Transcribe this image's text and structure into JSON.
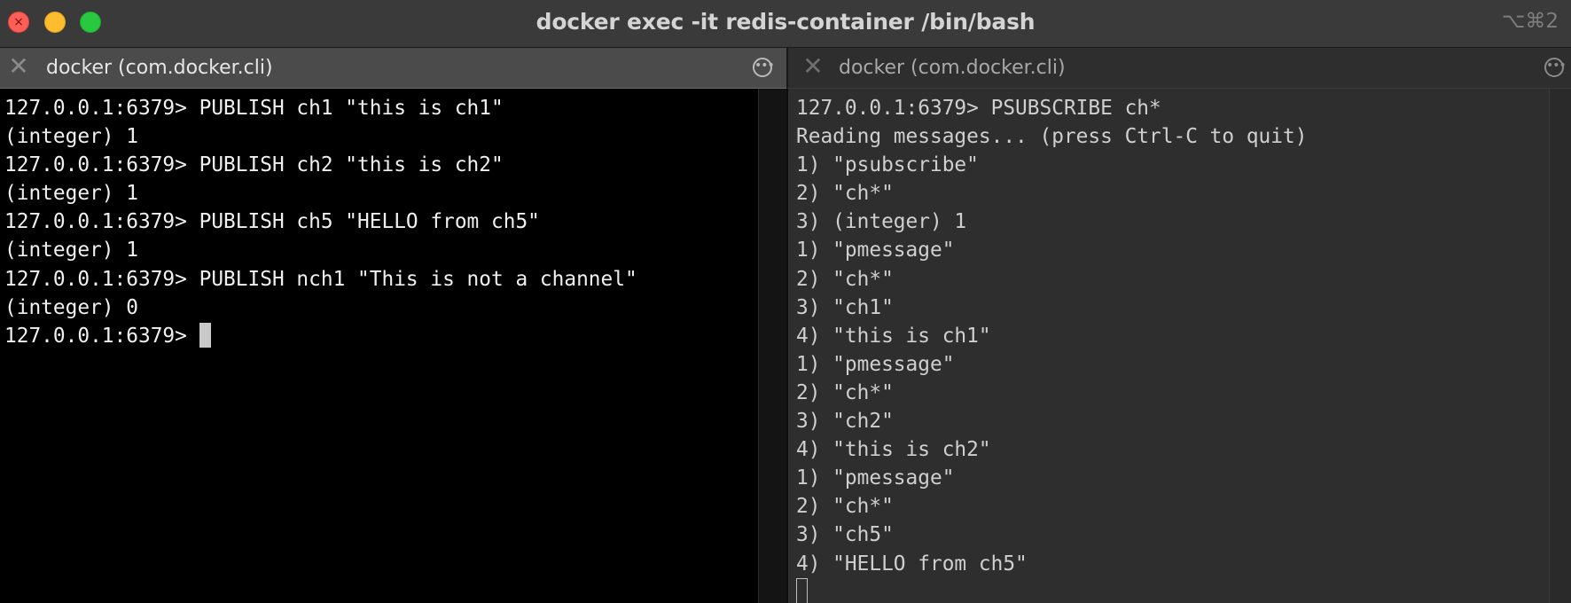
{
  "window": {
    "title": "docker exec -it redis-container /bin/bash",
    "shortcut": "⌥⌘2"
  },
  "left_pane": {
    "tab_label": "docker (com.docker.cli)",
    "lines": [
      "127.0.0.1:6379> PUBLISH ch1 \"this is ch1\"",
      "(integer) 1",
      "127.0.0.1:6379> PUBLISH ch2 \"this is ch2\"",
      "(integer) 1",
      "127.0.0.1:6379> PUBLISH ch5 \"HELLO from ch5\"",
      "(integer) 1",
      "127.0.0.1:6379> PUBLISH nch1 \"This is not a channel\"",
      "(integer) 0"
    ],
    "prompt": "127.0.0.1:6379> "
  },
  "right_pane": {
    "tab_label": "docker (com.docker.cli)",
    "lines": [
      "127.0.0.1:6379> PSUBSCRIBE ch*",
      "Reading messages... (press Ctrl-C to quit)",
      "1) \"psubscribe\"",
      "2) \"ch*\"",
      "3) (integer) 1",
      "1) \"pmessage\"",
      "2) \"ch*\"",
      "3) \"ch1\"",
      "4) \"this is ch1\"",
      "1) \"pmessage\"",
      "2) \"ch*\"",
      "3) \"ch2\"",
      "4) \"this is ch2\"",
      "1) \"pmessage\"",
      "2) \"ch*\"",
      "3) \"ch5\"",
      "4) \"HELLO from ch5\""
    ]
  },
  "icons": {
    "close": "×",
    "tab_close": "✕",
    "more": "•••"
  },
  "colors": {
    "close_button": "#ff5f57",
    "minimize_button": "#febc2e",
    "maximize_button": "#28c840"
  }
}
